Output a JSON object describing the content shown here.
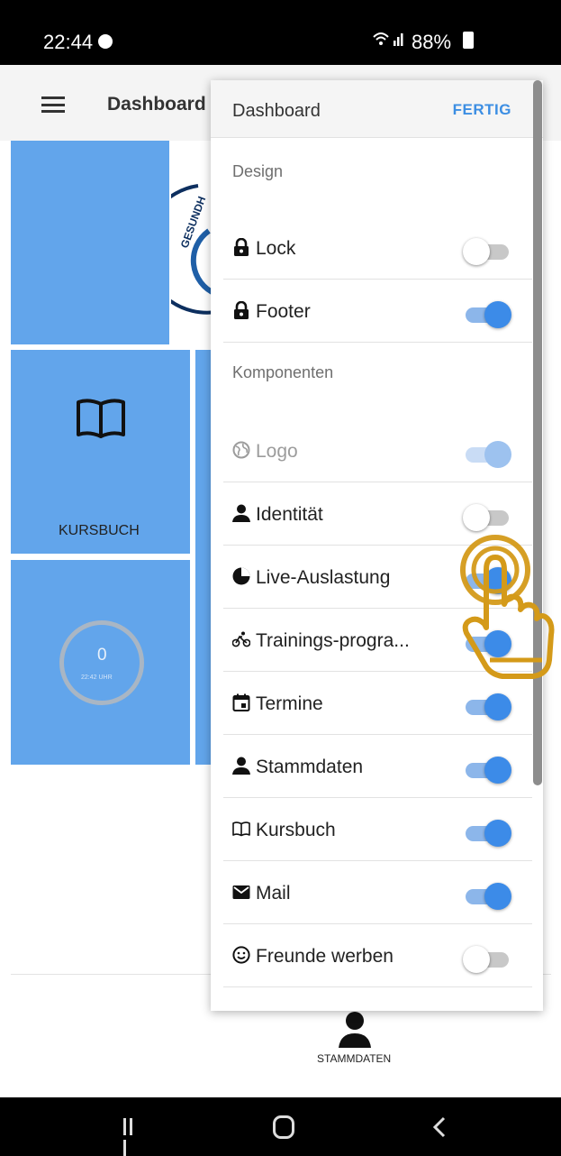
{
  "status_bar": {
    "time": "22:44",
    "battery": "88%",
    "signal_icon": "wifi-signal-icon"
  },
  "app_bar": {
    "title": "Dashboard",
    "menu_icon": "hamburger-menu-icon"
  },
  "dashboard": {
    "kursbuch_label": "KURSBUCH",
    "gauge_value": "0",
    "gauge_unit": "22:42 UHR",
    "bottom_nav_label": "STAMMDATEN",
    "logo_text": "GESUNDH"
  },
  "panel": {
    "title": "Dashboard",
    "done_label": "FERTIG",
    "sections": [
      {
        "label": "Design",
        "items": [
          {
            "label": "Lock",
            "icon": "lock-icon",
            "enabled": false
          },
          {
            "label": "Footer",
            "icon": "lock-icon",
            "enabled": true
          }
        ]
      },
      {
        "label": "Komponenten",
        "items": [
          {
            "label": "Logo",
            "icon": "globe-icon",
            "enabled": true,
            "disabled": true
          },
          {
            "label": "Identität",
            "icon": "person-icon",
            "enabled": false
          },
          {
            "label": "Live-Auslastung",
            "icon": "pie-chart-icon",
            "enabled": true
          },
          {
            "label": "Trainings-progra...",
            "icon": "bicycle-icon",
            "enabled": true
          },
          {
            "label": "Termine",
            "icon": "calendar-icon",
            "enabled": true
          },
          {
            "label": "Stammdaten",
            "icon": "person-icon",
            "enabled": true
          },
          {
            "label": "Kursbuch",
            "icon": "book-icon",
            "enabled": true
          },
          {
            "label": "Mail",
            "icon": "envelope-icon",
            "enabled": true
          },
          {
            "label": "Freunde werben",
            "icon": "smiley-icon",
            "enabled": false
          }
        ]
      }
    ]
  },
  "colors": {
    "accent": "#3c8be8",
    "tile": "#62a5eb",
    "done": "#3c8ee3",
    "tap_hint": "#d49a19"
  },
  "overlay": {
    "tap_hint_icon": "tap-hand-icon"
  }
}
